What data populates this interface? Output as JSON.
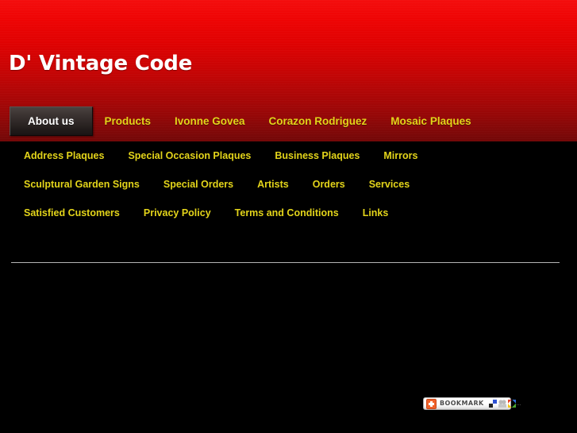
{
  "site": {
    "title": "D' Vintage Code",
    "header_gradient_top": "#f40d0d",
    "header_gradient_bottom": "#720707",
    "body_background": "#000000",
    "link_color": "#e3d41a",
    "active_tab_text_color": "#ffffff"
  },
  "primary_nav": {
    "items": [
      {
        "label": "About us",
        "active": true
      },
      {
        "label": "Products",
        "active": false
      },
      {
        "label": "Ivonne Govea",
        "active": false
      },
      {
        "label": "Corazon Rodriguez",
        "active": false
      },
      {
        "label": "Mosaic Plaques",
        "active": false
      }
    ]
  },
  "secondary_nav": {
    "rows": [
      [
        {
          "label": "Address Plaques"
        },
        {
          "label": "Special Occasion Plaques"
        },
        {
          "label": "Business Plaques"
        },
        {
          "label": "Mirrors"
        }
      ],
      [
        {
          "label": "Sculptural Garden Signs"
        },
        {
          "label": "Special Orders"
        },
        {
          "label": "Artists"
        },
        {
          "label": "Orders"
        },
        {
          "label": "Services"
        }
      ],
      [
        {
          "label": "Satisfied Customers"
        },
        {
          "label": "Privacy Policy"
        },
        {
          "label": "Terms and Conditions"
        },
        {
          "label": "Links"
        }
      ]
    ]
  },
  "bookmark_widget": {
    "label": "BOOKMARK",
    "plus_icon": "plus-icon",
    "plus_icon_color": "#f0622a",
    "share_icons": [
      {
        "name": "delicious-icon"
      },
      {
        "name": "stumbleupon-icon"
      },
      {
        "name": "windows-live-icon"
      }
    ],
    "more_label": "..."
  }
}
